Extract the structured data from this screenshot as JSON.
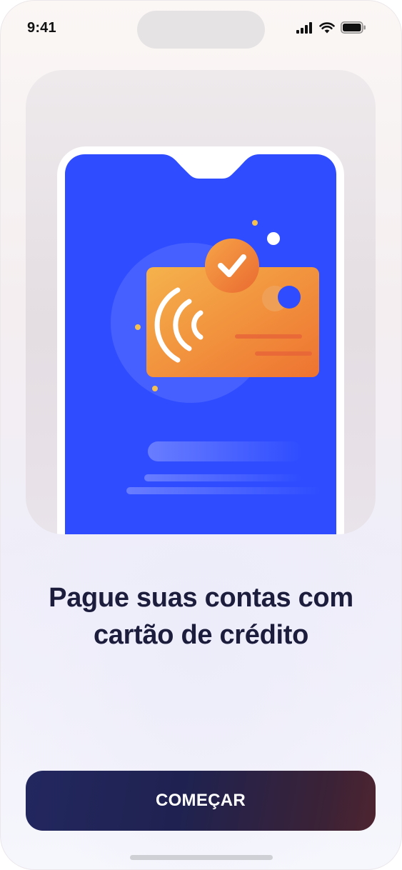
{
  "status_bar": {
    "time": "9:41",
    "icons": [
      "signal-icon",
      "wifi-icon",
      "battery-icon"
    ]
  },
  "hero": {
    "illustration": "credit-card-contactless-payment",
    "card_color_start": "#f5b24c",
    "card_color_end": "#ee7330",
    "screen_color": "#2f4dff"
  },
  "title_line1": "Pague suas contas com",
  "title_line2": "cartão de crédito",
  "cta": {
    "label": "COMEÇAR"
  },
  "colors": {
    "title": "#1c1c3d",
    "button_start": "#22275f",
    "button_end": "#4e2430"
  }
}
